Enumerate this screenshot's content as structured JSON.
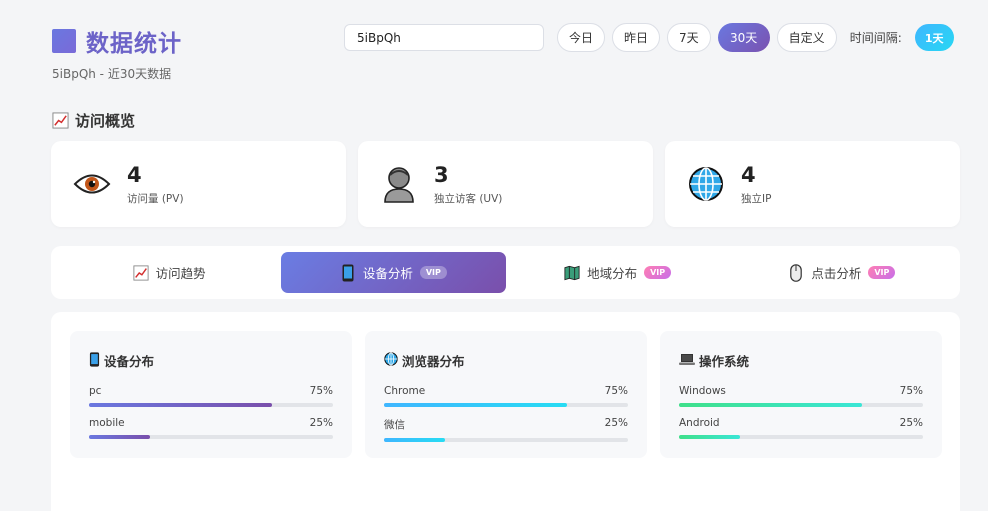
{
  "header": {
    "title": "数据统计",
    "subtitle": "5iBpQh - 近30天数据",
    "search_value": "5iBpQh",
    "range_buttons": [
      "今日",
      "昨日",
      "7天",
      "30天",
      "自定义"
    ],
    "active_range": "30天",
    "interval_label": "时间间隔:",
    "interval_value": "1天"
  },
  "overview": {
    "heading": "访问概览",
    "cards": [
      {
        "value": "4",
        "label": "访问量 (PV)",
        "icon": "eye-icon"
      },
      {
        "value": "3",
        "label": "独立访客 (UV)",
        "icon": "person-icon"
      },
      {
        "value": "4",
        "label": "独立IP",
        "icon": "globe-icon"
      }
    ]
  },
  "tabs": [
    {
      "label": "访问趋势",
      "icon": "chart-icon",
      "vip": ""
    },
    {
      "label": "设备分析",
      "icon": "phone-icon",
      "vip": "VIP"
    },
    {
      "label": "地域分布",
      "icon": "map-icon",
      "vip": "VIP"
    },
    {
      "label": "点击分析",
      "icon": "mouse-icon",
      "vip": "VIP"
    }
  ],
  "panels": [
    {
      "title": "设备分布",
      "icon": "phone-icon",
      "colors": [
        "#6a78e0",
        "#7a4fab"
      ],
      "rows": [
        {
          "name": "pc",
          "pct": "75%",
          "value": 0.75
        },
        {
          "name": "mobile",
          "pct": "25%",
          "value": 0.25
        }
      ]
    },
    {
      "title": "浏览器分布",
      "icon": "globe-icon",
      "colors": [
        "#3fb6ff",
        "#27dcf3"
      ],
      "rows": [
        {
          "name": "Chrome",
          "pct": "75%",
          "value": 0.75
        },
        {
          "name": "微信",
          "pct": "25%",
          "value": 0.25
        }
      ]
    },
    {
      "title": "操作系统",
      "icon": "laptop-icon",
      "colors": [
        "#3fe08a",
        "#3ae6d6"
      ],
      "rows": [
        {
          "name": "Windows",
          "pct": "75%",
          "value": 0.75
        },
        {
          "name": "Android",
          "pct": "25%",
          "value": 0.25
        }
      ]
    }
  ]
}
